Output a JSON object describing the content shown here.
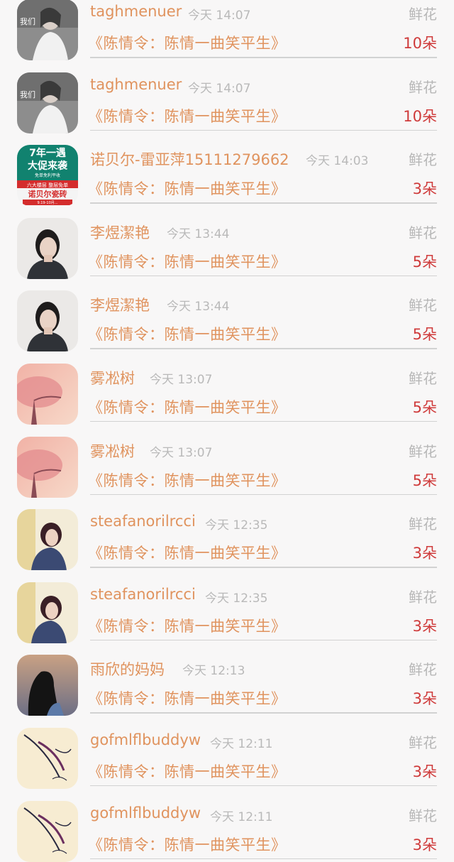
{
  "gift_list": [
    {
      "name": "taghmenuer",
      "time": "今天 14:07",
      "kind": "鲜花",
      "title": "《陈情令：陈情一曲笑平生》",
      "count": "10朵",
      "avatar": "sunglasses-girl-avatar"
    },
    {
      "name": "taghmenuer",
      "time": "今天 14:07",
      "kind": "鲜花",
      "title": "《陈情令：陈情一曲笑平生》",
      "count": "10朵",
      "avatar": "sunglasses-girl-avatar"
    },
    {
      "name": "诺贝尔-雷亚萍15111279662",
      "time": "今天 14:03",
      "kind": "鲜花",
      "title": "《陈情令：陈情一曲笑平生》",
      "count": "3朵",
      "avatar": "promo-ad-avatar",
      "promo_text": {
        "line1": "7年一遇",
        "line2": "大促来袭",
        "line3": "免单免利平收",
        "line4": "六大楼层 整层免单",
        "line5": "诺贝尔瓷砖",
        "line6": "9.19-10月..."
      }
    },
    {
      "name": "李煜潔艳",
      "time": "今天 13:44",
      "kind": "鲜花",
      "title": "《陈情令：陈情一曲笑平生》",
      "count": "5朵",
      "avatar": "portrait-girl-avatar"
    },
    {
      "name": "李煜潔艳",
      "time": "今天 13:44",
      "kind": "鲜花",
      "title": "《陈情令：陈情一曲笑平生》",
      "count": "5朵",
      "avatar": "portrait-girl-avatar"
    },
    {
      "name": "雾凇树",
      "time": "今天 13:07",
      "kind": "鲜花",
      "title": "《陈情令：陈情一曲笑平生》",
      "count": "5朵",
      "avatar": "pink-tree-avatar"
    },
    {
      "name": "雾凇树",
      "time": "今天 13:07",
      "kind": "鲜花",
      "title": "《陈情令：陈情一曲笑平生》",
      "count": "5朵",
      "avatar": "pink-tree-avatar"
    },
    {
      "name": "steafanorilrcci",
      "time": "今天 12:35",
      "kind": "鲜花",
      "title": "《陈情令：陈情一曲笑平生》",
      "count": "3朵",
      "avatar": "woman-window-avatar"
    },
    {
      "name": "steafanorilrcci",
      "time": "今天 12:35",
      "kind": "鲜花",
      "title": "《陈情令：陈情一曲笑平生》",
      "count": "3朵",
      "avatar": "woman-window-avatar"
    },
    {
      "name": "雨欣的妈妈",
      "time": "今天 12:13",
      "kind": "鲜花",
      "title": "《陈情令：陈情一曲笑平生》",
      "count": "3朵",
      "avatar": "sunset-silhouette-avatar"
    },
    {
      "name": "gofmlflbuddyw",
      "time": "今天 12:11",
      "kind": "鲜花",
      "title": "《陈情令：陈情一曲笑平生》",
      "count": "3朵",
      "avatar": "sketch-art-avatar"
    },
    {
      "name": "gofmlflbuddyw",
      "time": "今天 12:11",
      "kind": "鲜花",
      "title": "《陈情令：陈情一曲笑平生》",
      "count": "3朵",
      "avatar": "sketch-art-avatar"
    }
  ],
  "colors": {
    "name": "#e0935e",
    "title": "#e0935e",
    "count": "#cf3b3b",
    "time": "#b9b9b9",
    "kind": "#b7b7b7",
    "divider": "#d2d2d2"
  }
}
